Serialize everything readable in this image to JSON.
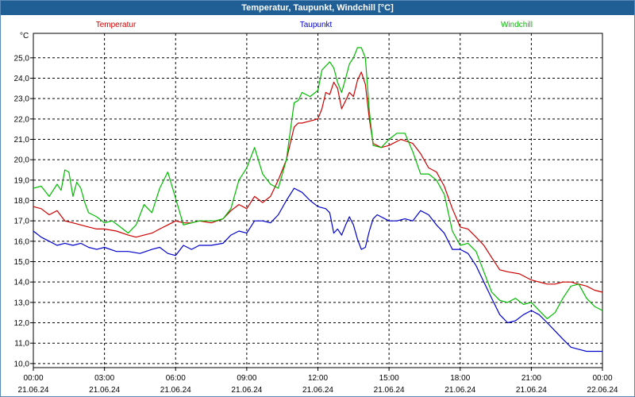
{
  "window": {
    "title": "Temperatur, Taupunkt, Windchill [°C]"
  },
  "chart_data": {
    "type": "line",
    "title": "Temperatur, Taupunkt, Windchill [°C]",
    "ylabel": "°C",
    "ylim": [
      9.8,
      26.2
    ],
    "xlim": [
      0,
      24
    ],
    "grid": true,
    "legend_position": "top",
    "y_ticks": [
      "10,0",
      "11,0",
      "12,0",
      "13,0",
      "14,0",
      "15,0",
      "16,0",
      "17,0",
      "18,0",
      "19,0",
      "20,0",
      "21,0",
      "22,0",
      "23,0",
      "24,0",
      "25,0"
    ],
    "x_ticks": [
      {
        "time": "00:00",
        "date": "21.06.24"
      },
      {
        "time": "03:00",
        "date": "21.06.24"
      },
      {
        "time": "06:00",
        "date": "21.06.24"
      },
      {
        "time": "09:00",
        "date": "21.06.24"
      },
      {
        "time": "12:00",
        "date": "21.06.24"
      },
      {
        "time": "15:00",
        "date": "21.06.24"
      },
      {
        "time": "18:00",
        "date": "21.06.24"
      },
      {
        "time": "21:00",
        "date": "21.06.24"
      },
      {
        "time": "00:00",
        "date": "22.06.24"
      }
    ],
    "series": [
      {
        "name": "Temperatur",
        "color": "#cc0000",
        "x": [
          0,
          0.33,
          0.67,
          1.0,
          1.33,
          1.67,
          2.0,
          2.33,
          2.67,
          3.0,
          3.5,
          4.0,
          4.33,
          4.67,
          5.0,
          5.33,
          5.67,
          6.0,
          6.33,
          6.67,
          7.0,
          7.5,
          8.0,
          8.33,
          8.67,
          9.0,
          9.33,
          9.67,
          10.0,
          10.33,
          10.67,
          11.0,
          11.17,
          11.33,
          11.67,
          12.0,
          12.17,
          12.33,
          12.5,
          12.67,
          12.83,
          13.0,
          13.17,
          13.33,
          13.5,
          13.67,
          13.83,
          14.0,
          14.17,
          14.33,
          14.67,
          15.0,
          15.5,
          16.0,
          16.33,
          16.67,
          17.0,
          17.33,
          17.67,
          18.0,
          18.33,
          18.67,
          19.0,
          19.33,
          19.67,
          20.0,
          20.5,
          21.0,
          21.33,
          21.67,
          22.0,
          22.33,
          22.67,
          23.0,
          23.33,
          23.67,
          24.0
        ],
        "y": [
          17.7,
          17.6,
          17.3,
          17.5,
          17.0,
          16.9,
          16.8,
          16.7,
          16.6,
          16.6,
          16.5,
          16.3,
          16.2,
          16.3,
          16.4,
          16.6,
          16.8,
          17.0,
          16.9,
          16.9,
          17.0,
          16.9,
          17.1,
          17.5,
          17.8,
          17.6,
          18.2,
          17.9,
          18.2,
          19.0,
          20.0,
          21.6,
          21.8,
          21.8,
          21.9,
          22.0,
          22.5,
          23.3,
          23.2,
          23.8,
          23.5,
          22.5,
          22.9,
          23.3,
          23.1,
          23.9,
          24.3,
          23.7,
          22.0,
          20.8,
          20.6,
          20.7,
          21.0,
          20.8,
          20.3,
          19.6,
          19.4,
          18.7,
          17.6,
          16.7,
          16.6,
          16.2,
          15.8,
          15.2,
          14.6,
          14.5,
          14.4,
          14.1,
          14.0,
          13.9,
          13.9,
          14.0,
          14.0,
          13.9,
          13.8,
          13.6,
          13.5
        ]
      },
      {
        "name": "Taupunkt",
        "color": "#0000cc",
        "x": [
          0,
          0.33,
          0.67,
          1.0,
          1.33,
          1.67,
          2.0,
          2.33,
          2.67,
          3.0,
          3.5,
          4.0,
          4.5,
          5.0,
          5.33,
          5.67,
          6.0,
          6.33,
          6.67,
          7.0,
          7.5,
          8.0,
          8.33,
          8.67,
          9.0,
          9.33,
          9.67,
          10.0,
          10.33,
          10.67,
          11.0,
          11.33,
          11.67,
          12.0,
          12.33,
          12.5,
          12.67,
          12.83,
          13.0,
          13.17,
          13.33,
          13.5,
          13.67,
          13.83,
          14.0,
          14.17,
          14.33,
          14.5,
          15.0,
          15.33,
          15.67,
          16.0,
          16.33,
          16.67,
          17.0,
          17.33,
          17.67,
          18.0,
          18.33,
          18.67,
          19.0,
          19.33,
          19.67,
          20.0,
          20.33,
          20.67,
          21.0,
          21.33,
          21.67,
          22.0,
          22.33,
          22.67,
          23.0,
          23.33,
          23.67,
          24.0
        ],
        "y": [
          16.5,
          16.2,
          16.0,
          15.8,
          15.9,
          15.8,
          15.9,
          15.7,
          15.6,
          15.7,
          15.5,
          15.5,
          15.4,
          15.6,
          15.7,
          15.4,
          15.3,
          15.8,
          15.6,
          15.8,
          15.8,
          15.9,
          16.3,
          16.5,
          16.4,
          17.0,
          17.0,
          16.9,
          17.3,
          18.0,
          18.6,
          18.4,
          18.0,
          17.7,
          17.6,
          17.4,
          16.4,
          16.6,
          16.3,
          16.8,
          17.2,
          16.8,
          16.1,
          15.6,
          15.7,
          16.5,
          17.1,
          17.3,
          17.0,
          17.0,
          17.1,
          17.0,
          17.5,
          17.3,
          16.8,
          16.4,
          15.6,
          15.6,
          15.4,
          14.8,
          14.0,
          13.2,
          12.4,
          12.0,
          12.1,
          12.4,
          12.6,
          12.4,
          12.0,
          11.6,
          11.2,
          10.8,
          10.7,
          10.6,
          10.6,
          10.6
        ]
      },
      {
        "name": "Windchill",
        "color": "#00bb00",
        "x": [
          0,
          0.33,
          0.67,
          1.0,
          1.17,
          1.33,
          1.5,
          1.67,
          1.83,
          2.0,
          2.17,
          2.33,
          2.67,
          3.0,
          3.33,
          3.67,
          4.0,
          4.33,
          4.67,
          5.0,
          5.33,
          5.67,
          6.0,
          6.33,
          6.67,
          7.0,
          7.33,
          7.67,
          8.0,
          8.33,
          8.67,
          9.0,
          9.33,
          9.67,
          10.0,
          10.33,
          10.67,
          11.0,
          11.17,
          11.33,
          11.67,
          12.0,
          12.17,
          12.33,
          12.5,
          12.67,
          12.83,
          13.0,
          13.17,
          13.33,
          13.5,
          13.67,
          13.83,
          14.0,
          14.17,
          14.33,
          14.67,
          15.0,
          15.33,
          15.67,
          16.0,
          16.33,
          16.67,
          17.0,
          17.33,
          17.67,
          18.0,
          18.33,
          18.67,
          19.0,
          19.33,
          19.67,
          20.0,
          20.33,
          20.67,
          21.0,
          21.33,
          21.67,
          22.0,
          22.33,
          22.67,
          23.0,
          23.33,
          23.67,
          24.0
        ],
        "y": [
          18.6,
          18.7,
          18.2,
          18.8,
          18.5,
          19.5,
          19.4,
          18.2,
          18.9,
          18.6,
          17.9,
          17.4,
          17.2,
          16.9,
          17.0,
          16.7,
          16.4,
          16.8,
          17.8,
          17.4,
          18.6,
          19.4,
          18.1,
          16.8,
          16.9,
          17.0,
          17.0,
          17.0,
          17.1,
          17.6,
          19.0,
          19.6,
          20.6,
          19.3,
          18.8,
          18.6,
          20.0,
          22.8,
          22.9,
          23.3,
          23.1,
          23.4,
          24.4,
          24.6,
          24.8,
          24.5,
          23.8,
          23.3,
          24.0,
          24.7,
          25.0,
          25.5,
          25.5,
          25.0,
          22.4,
          20.7,
          20.6,
          21.0,
          21.3,
          21.3,
          20.4,
          19.3,
          19.3,
          19.0,
          18.3,
          16.5,
          15.8,
          15.9,
          15.5,
          14.5,
          13.5,
          13.1,
          13.0,
          13.2,
          12.9,
          13.0,
          12.6,
          12.2,
          12.5,
          13.2,
          13.8,
          13.9,
          13.2,
          12.8,
          12.6
        ]
      }
    ]
  }
}
